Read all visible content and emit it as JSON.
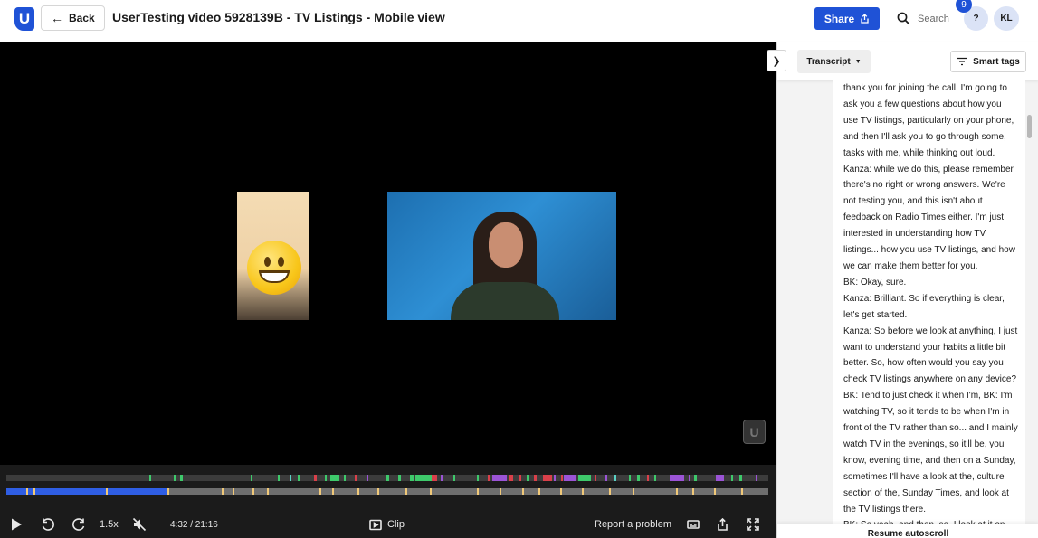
{
  "header": {
    "logo_text": "U",
    "back_label": "Back",
    "title": "UserTesting video 5928139B - TV Listings - Mobile view",
    "share_label": "Share",
    "search_label": "Search",
    "help_label": "?",
    "notification_count": "9",
    "user_initials": "KL"
  },
  "video": {
    "watermark": "U"
  },
  "controls": {
    "speed": "1.5x",
    "time": "4:32 / 21:16",
    "progress_fraction": 0.213,
    "clip_label": "Clip",
    "report_label": "Report a problem",
    "skip_seconds": "5"
  },
  "colors": {
    "brand": "#1f52d6",
    "progress": "#2f5ee4",
    "tag_green": "#3ec96b",
    "tag_red": "#d9404a",
    "tag_purple": "#9b54d6",
    "tag_teal": "#5ad1c5",
    "marker_yellow": "#f0c878"
  },
  "panel": {
    "transcript_label": "Transcript",
    "smart_tags_label": "Smart tags",
    "resume_label": "Resume autoscroll",
    "lines": [
      "thank you for joining the call. I'm going to",
      "ask you a few questions about how you",
      "use TV listings, particularly on your phone,",
      "and then I'll ask you to go through some,",
      "tasks with me, while thinking out loud.",
      "Kanza: while we do this, please remember",
      "there's no right or wrong answers. We're",
      "not testing you, and this isn't about",
      "feedback on Radio Times either. I'm just",
      "interested in understanding how TV",
      "listings... how you use TV listings, and how",
      "we can make them better for you.",
      "BK: Okay, sure.",
      "Kanza: Brilliant. So if everything is clear,",
      "let's get started.",
      "Kanza: So before we look at anything, I just",
      "want to understand your habits a little bit",
      "better. So, how often would you say you",
      "check TV listings anywhere on any device?",
      "BK: Tend to just check it when I'm, BK: I'm",
      "watching TV, so it tends to be when I'm in",
      "front of the TV rather than so... and I mainly",
      "watch TV in the evenings, so it'll be, you",
      "know, evening time, and then on a Sunday,",
      "sometimes I'll have a look at the, culture",
      "section of the, Sunday Times, and look at",
      "the TV listings there.",
      "BK: So yeah, and then, so, I look at it on,"
    ]
  }
}
